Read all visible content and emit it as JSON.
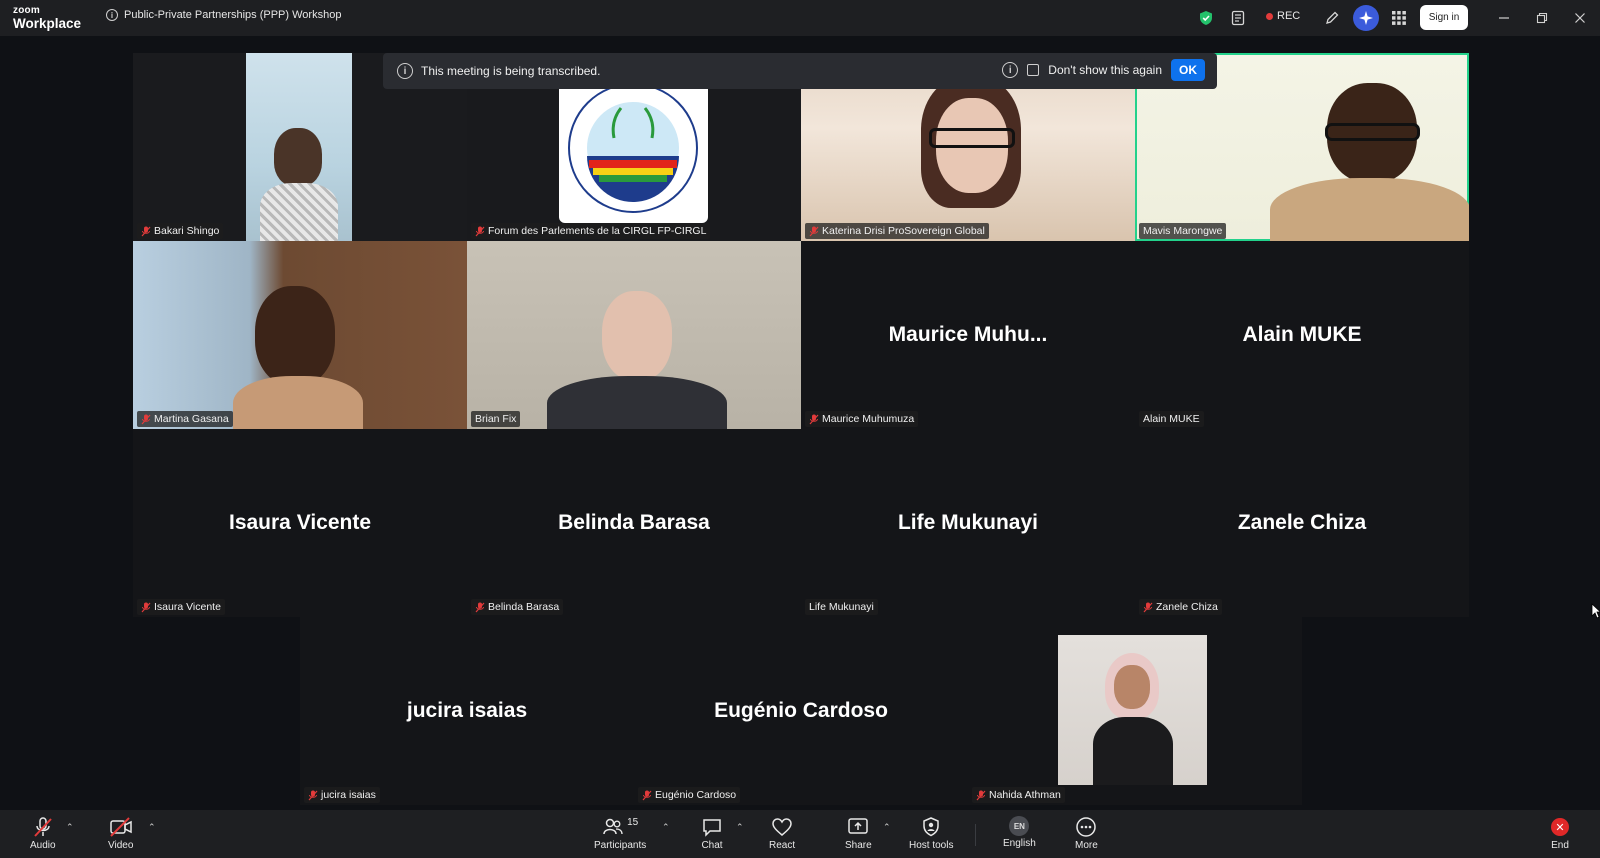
{
  "app": {
    "logo_top": "zoom",
    "logo_bottom": "Workplace",
    "meeting_title": "Public-Private Partnerships (PPP) Workshop"
  },
  "titlebar": {
    "rec_label": "REC",
    "sign_in": "Sign in"
  },
  "banner": {
    "message": "This meeting is being transcribed.",
    "dont_show": "Don't show this again",
    "ok": "OK"
  },
  "tiles": {
    "bakari": "Bakari Shingo",
    "forum": "Forum des Parlements de la CIRGL FP-CIRGL",
    "katerina": "Katerina Drisi ProSovereign Global",
    "mavis": "Mavis Marongwe",
    "martina": "Martina Gasana",
    "brian": "Brian Fix",
    "maurice_big": "Maurice  Muhu...",
    "maurice": "Maurice Muhumuza",
    "alain_big": "Alain MUKE",
    "alain": "Alain MUKE",
    "isaura_big": "Isaura Vicente",
    "isaura": "Isaura Vicente",
    "belinda_big": "Belinda Barasa",
    "belinda": "Belinda Barasa",
    "life_big": "Life Mukunayi",
    "life": "Life Mukunayi",
    "zanele_big": "Zanele Chiza",
    "zanele": "Zanele Chiza",
    "jucira_big": "jucira isaias",
    "jucira": "jucira isaias",
    "eugenio_big": "Eugénio Cardoso",
    "eugenio": "Eugénio Cardoso",
    "nahida": "Nahida Athman"
  },
  "toolbar": {
    "audio": "Audio",
    "video": "Video",
    "participants": "Participants",
    "participants_count": "15",
    "chat": "Chat",
    "react": "React",
    "share": "Share",
    "host_tools": "Host tools",
    "language_badge": "EN",
    "english": "English",
    "more": "More",
    "end": "End"
  },
  "colors": {
    "accent": "#0e72ed",
    "active_speaker": "#23d18b",
    "muted_red": "#e23b3b",
    "end_red": "#e02828"
  }
}
